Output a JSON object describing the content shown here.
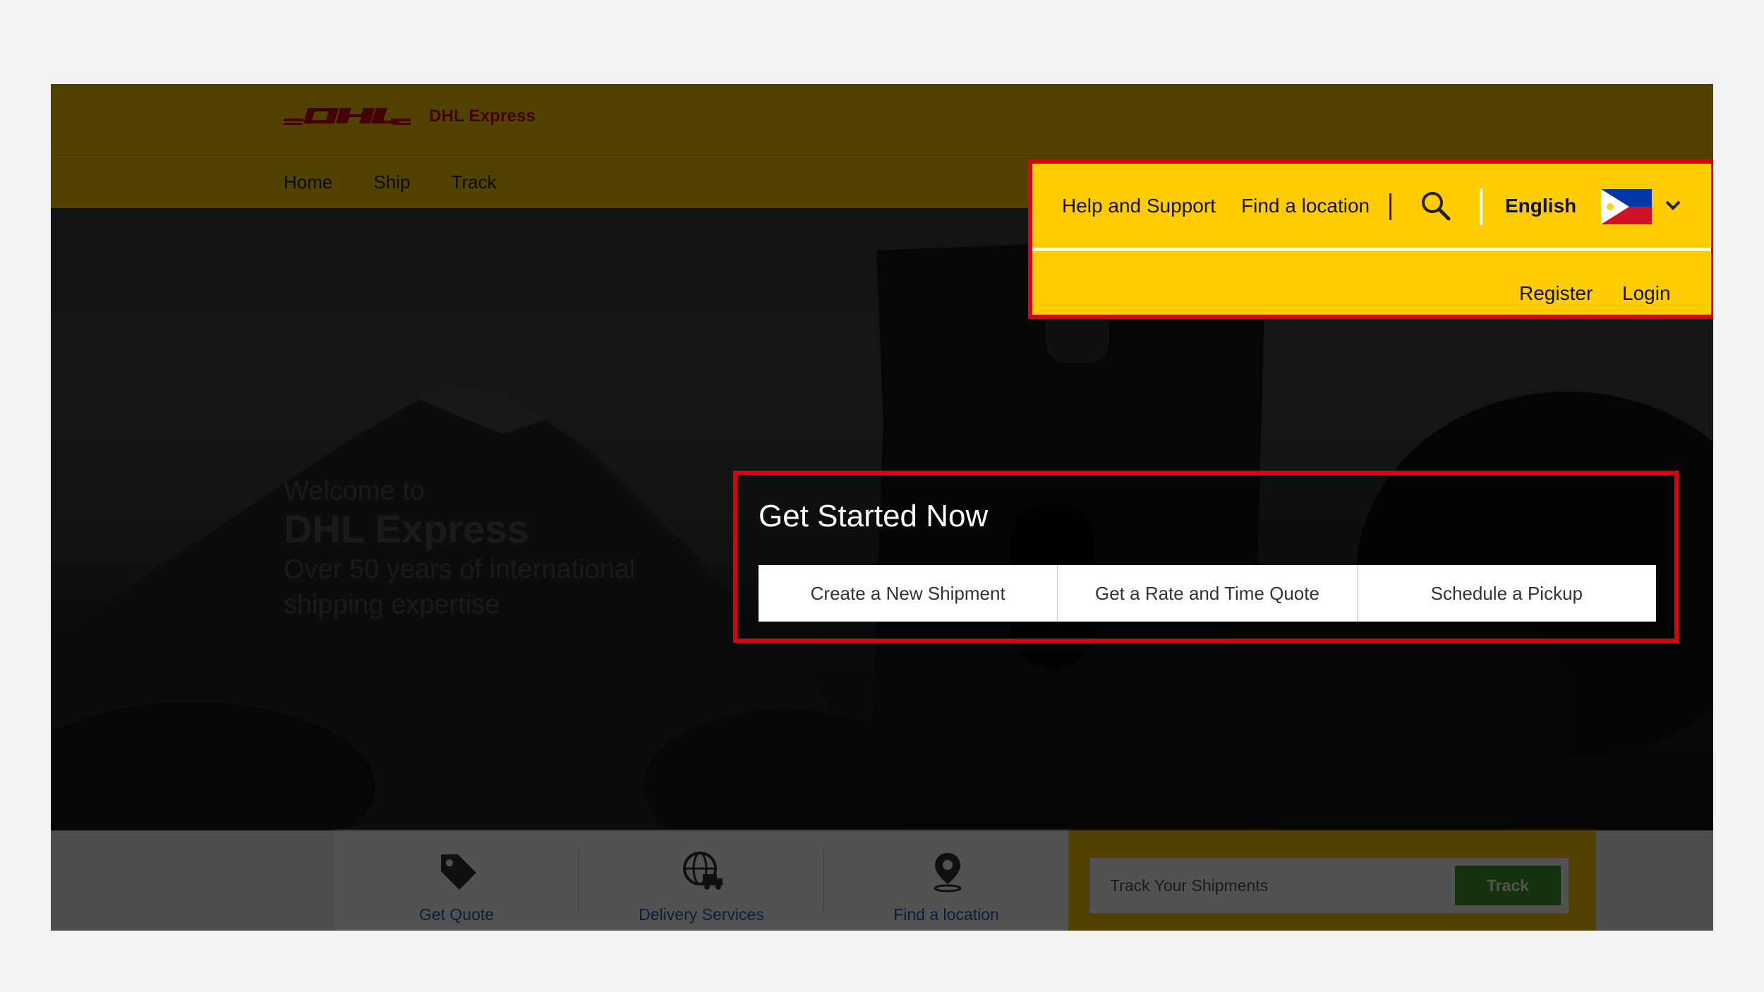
{
  "brand": {
    "logo_text": "DHL Express",
    "colors": {
      "yellow": "#ffcc00",
      "red": "#d40511",
      "green": "#3d9c2a",
      "link_blue": "#1a63b3"
    }
  },
  "nav": {
    "items": [
      {
        "label": "Home"
      },
      {
        "label": "Ship"
      },
      {
        "label": "Track"
      }
    ]
  },
  "utility": {
    "help_label": "Help and Support",
    "find_location_label": "Find a location",
    "search_icon": "search-icon",
    "language_label": "English",
    "flag": "philippines-flag-icon",
    "register_label": "Register",
    "login_label": "Login"
  },
  "hero": {
    "welcome_line1": "Welcome to",
    "welcome_line2": "DHL Express",
    "welcome_line3": "Over 50 years of international shipping expertise"
  },
  "get_started": {
    "title": "Get Started Now",
    "buttons": [
      {
        "label": "Create a New Shipment"
      },
      {
        "label": "Get a Rate and Time Quote"
      },
      {
        "label": "Schedule a Pickup"
      }
    ]
  },
  "quick_links": [
    {
      "label": "Get Quote",
      "icon": "price-tag-icon"
    },
    {
      "label": "Delivery Services",
      "icon": "globe-truck-icon"
    },
    {
      "label": "Find a location",
      "icon": "map-pin-icon"
    }
  ],
  "tracking": {
    "placeholder": "Track Your Shipments",
    "button_label": "Track"
  }
}
